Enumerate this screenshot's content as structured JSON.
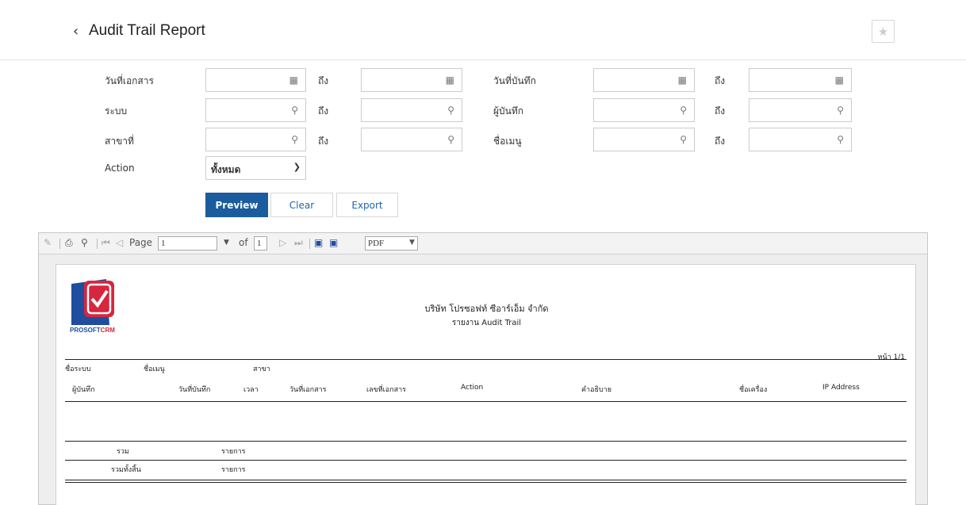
{
  "header": {
    "back_icon": "chevron-left-icon",
    "title": "Audit Trail Report",
    "favorite_icon": "star-icon"
  },
  "filters": {
    "doc_date_label": "วันที่เอกสาร",
    "to_label": "ถึง",
    "record_date_label": "วันที่บันทึก",
    "system_label": "ระบบ",
    "recorder_label": "ผู้บันทึก",
    "branch_label": "สาขาที่",
    "menu_name_label": "ชื่อเมนู",
    "action_label": "Action",
    "action_value": "ทั้งหมด"
  },
  "buttons": {
    "preview": "Preview",
    "clear": "Clear",
    "export": "Export"
  },
  "viewer": {
    "page_label": "Page",
    "page_value": "1",
    "of_label": "of",
    "total_pages": "1",
    "format_value": "PDF"
  },
  "report": {
    "logo_text_a": "PROSOFT",
    "logo_text_b": "CRM",
    "company": "บริษัท โปรซอฟท์ ซีอาร์เอ็ม จำกัด",
    "subtitle": "รายงาน Audit Trail",
    "page_no": "หน้า 1/1",
    "group_headers": [
      "ชื่อระบบ",
      "ชื่อเมนู",
      "สาขา"
    ],
    "columns": [
      "ผู้บันทึก",
      "วันที่บันทึก",
      "เวลา",
      "วันที่เอกสาร",
      "เลขที่เอกสาร",
      "Action",
      "คำอธิบาย",
      "ชื่อเครื่อง",
      "IP Address"
    ],
    "total_label": "รวม",
    "total_unit": "รายการ",
    "grand_total_label": "รวมทั้งสิ้น",
    "grand_total_unit": "รายการ"
  },
  "colors": {
    "primary": "#1b5c9e",
    "logo_red": "#d7263d",
    "logo_blue": "#1f4e9e"
  }
}
